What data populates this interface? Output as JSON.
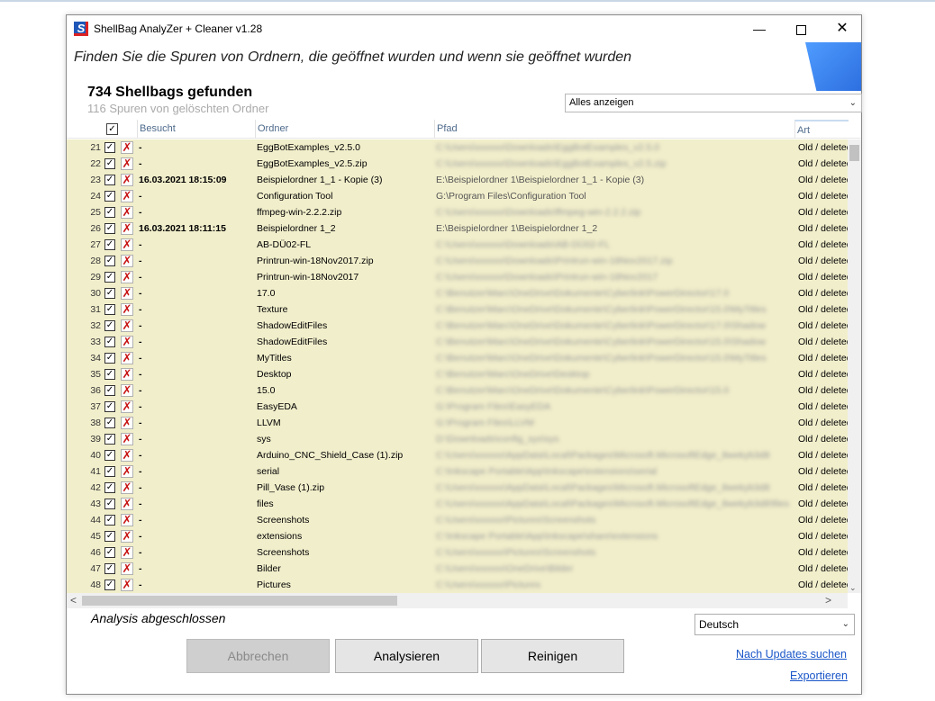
{
  "window": {
    "title": "ShellBag  AnalyZer + Cleaner v1.28",
    "icon_letter": "S",
    "min": "—",
    "close": "✕"
  },
  "header": {
    "subtitle": "Finden Sie die Spuren von Ordnern, die geöffnet wurden und wenn sie geöffnet wurden",
    "found": "734 Shellbags gefunden",
    "deleted": "116 Spuren von gelöschten Ordner"
  },
  "filter": {
    "value": "Alles anzeigen",
    "arrow": "⌄"
  },
  "grid": {
    "header_check": "✓",
    "columns": {
      "visited": "Besucht",
      "folder": "Ordner",
      "path": "Pfad",
      "kind": "Art"
    },
    "check_mark": "✓",
    "delete_mark": "✗",
    "rows": [
      {
        "num": "21",
        "visited": "-",
        "folder": "EggBotExamples_v2.5.0",
        "path": "C:\\Users\\xxxxxx\\Downloads\\EggBotExamples_v2.5.0",
        "blur": true,
        "kind": "Old / deleted"
      },
      {
        "num": "22",
        "visited": "-",
        "folder": "EggBotExamples_v2.5.zip",
        "path": "C:\\Users\\xxxxxx\\Downloads\\EggBotExamples_v2.5.zip",
        "blur": true,
        "kind": "Old / deleted"
      },
      {
        "num": "23",
        "visited": "16.03.2021 18:15:09",
        "folder": "Beispielordner 1_1 - Kopie (3)",
        "path": "E:\\Beispielordner 1\\Beispielordner 1_1 - Kopie (3)",
        "blur": false,
        "kind": "Old / deleted"
      },
      {
        "num": "24",
        "visited": "-",
        "folder": "Configuration Tool",
        "path": "G:\\Program Files\\Configuration Tool",
        "blur": false,
        "kind": "Old / deleted"
      },
      {
        "num": "25",
        "visited": "-",
        "folder": "ffmpeg-win-2.2.2.zip",
        "path": "C:\\Users\\xxxxxx\\Downloads\\ffmpeg-win-2.2.2.zip",
        "blur": true,
        "kind": "Old / deleted"
      },
      {
        "num": "26",
        "visited": "16.03.2021 18:11:15",
        "folder": "Beispielordner 1_2",
        "path": "E:\\Beispielordner 1\\Beispielordner 1_2",
        "blur": false,
        "kind": "Old / deleted"
      },
      {
        "num": "27",
        "visited": "-",
        "folder": "AB-DÜ02-FL",
        "path": "C:\\Users\\xxxxxx\\Downloads\\AB-DÜ02-FL",
        "blur": true,
        "kind": "Old / deleted"
      },
      {
        "num": "28",
        "visited": "-",
        "folder": "Printrun-win-18Nov2017.zip",
        "path": "C:\\Users\\xxxxxx\\Downloads\\Printrun-win-18Nov2017.zip",
        "blur": true,
        "kind": "Old / deleted"
      },
      {
        "num": "29",
        "visited": "-",
        "folder": "Printrun-win-18Nov2017",
        "path": "C:\\Users\\xxxxxx\\Downloads\\Printrun-win-18Nov2017",
        "blur": true,
        "kind": "Old / deleted"
      },
      {
        "num": "30",
        "visited": "-",
        "folder": "17.0",
        "path": "C:\\Benutzer\\Marc\\OneDrive\\Dokumente\\Cyberlink\\PowerDirector\\17.0",
        "blur": true,
        "kind": "Old / deleted"
      },
      {
        "num": "31",
        "visited": "-",
        "folder": "Texture",
        "path": "C:\\Benutzer\\Marc\\OneDrive\\Dokumente\\Cyberlink\\PowerDirector\\15.0\\MyTitles",
        "blur": true,
        "kind": "Old / deleted"
      },
      {
        "num": "32",
        "visited": "-",
        "folder": "ShadowEditFiles",
        "path": "C:\\Benutzer\\Marc\\OneDrive\\Dokumente\\Cyberlink\\PowerDirector\\17.0\\Shadow",
        "blur": true,
        "kind": "Old / deleted"
      },
      {
        "num": "33",
        "visited": "-",
        "folder": "ShadowEditFiles",
        "path": "C:\\Benutzer\\Marc\\OneDrive\\Dokumente\\Cyberlink\\PowerDirector\\15.0\\Shadow",
        "blur": true,
        "kind": "Old / deleted"
      },
      {
        "num": "34",
        "visited": "-",
        "folder": "MyTitles",
        "path": "C:\\Benutzer\\Marc\\OneDrive\\Dokumente\\Cyberlink\\PowerDirector\\15.0\\MyTitles",
        "blur": true,
        "kind": "Old / deleted"
      },
      {
        "num": "35",
        "visited": "-",
        "folder": "Desktop",
        "path": "C:\\Benutzer\\Marc\\OneDrive\\Desktop",
        "blur": true,
        "kind": "Old / deleted"
      },
      {
        "num": "36",
        "visited": "-",
        "folder": "15.0",
        "path": "C:\\Benutzer\\Marc\\OneDrive\\Dokumente\\Cyberlink\\PowerDirector\\15.0",
        "blur": true,
        "kind": "Old / deleted"
      },
      {
        "num": "37",
        "visited": "-",
        "folder": "EasyEDA",
        "path": "G:\\Program Files\\EasyEDA",
        "blur": true,
        "kind": "Old / deleted"
      },
      {
        "num": "38",
        "visited": "-",
        "folder": "LLVM",
        "path": "G:\\Program Files\\LLVM",
        "blur": true,
        "kind": "Old / deleted"
      },
      {
        "num": "39",
        "visited": "-",
        "folder": "sys",
        "path": "D:\\Downloads\\config_sys\\sys",
        "blur": true,
        "kind": "Old / deleted"
      },
      {
        "num": "40",
        "visited": "-",
        "folder": "Arduino_CNC_Shield_Case (1).zip",
        "path": "C:\\Users\\xxxxxx\\AppData\\Local\\Packages\\Microsoft.MicrosoftEdge_8wekyb3d8",
        "blur": true,
        "kind": "Old / deleted"
      },
      {
        "num": "41",
        "visited": "-",
        "folder": "serial",
        "path": "C:\\Inkscape Portable\\App\\Inkscape\\extensions\\serial",
        "blur": true,
        "kind": "Old / deleted"
      },
      {
        "num": "42",
        "visited": "-",
        "folder": "Pill_Vase (1).zip",
        "path": "C:\\Users\\xxxxxx\\AppData\\Local\\Packages\\Microsoft.MicrosoftEdge_8wekyb3d8",
        "blur": true,
        "kind": "Old / deleted"
      },
      {
        "num": "43",
        "visited": "-",
        "folder": "files",
        "path": "C:\\Users\\xxxxxx\\AppData\\Local\\Packages\\Microsoft.MicrosoftEdge_8wekyb3d8\\files",
        "blur": true,
        "kind": "Old / deleted"
      },
      {
        "num": "44",
        "visited": "-",
        "folder": "Screenshots",
        "path": "C:\\Users\\xxxxxx\\Pictures\\Screenshots",
        "blur": true,
        "kind": "Old / deleted"
      },
      {
        "num": "45",
        "visited": "-",
        "folder": "extensions",
        "path": "C:\\Inkscape Portable\\App\\Inkscape\\share\\extensions",
        "blur": true,
        "kind": "Old / deleted"
      },
      {
        "num": "46",
        "visited": "-",
        "folder": "Screenshots",
        "path": "C:\\Users\\xxxxxx\\Pictures\\Screenshots",
        "blur": true,
        "kind": "Old / deleted"
      },
      {
        "num": "47",
        "visited": "-",
        "folder": "Bilder",
        "path": "C:\\Users\\xxxxxx\\OneDrive\\Bilder",
        "blur": true,
        "kind": "Old / deleted"
      },
      {
        "num": "48",
        "visited": "-",
        "folder": "Pictures",
        "path": "C:\\Users\\xxxxxx\\Pictures",
        "blur": true,
        "kind": "Old / deleted"
      }
    ]
  },
  "scroll": {
    "left": "<",
    "right": ">",
    "down": "⌄"
  },
  "status": "Analysis abgeschlossen",
  "language": {
    "value": "Deutsch",
    "arrow": "⌄"
  },
  "buttons": {
    "cancel": "Abbrechen",
    "analyze": "Analysieren",
    "clean": "Reinigen"
  },
  "links": {
    "updates": "Nach Updates suchen",
    "export": "Exportieren"
  }
}
